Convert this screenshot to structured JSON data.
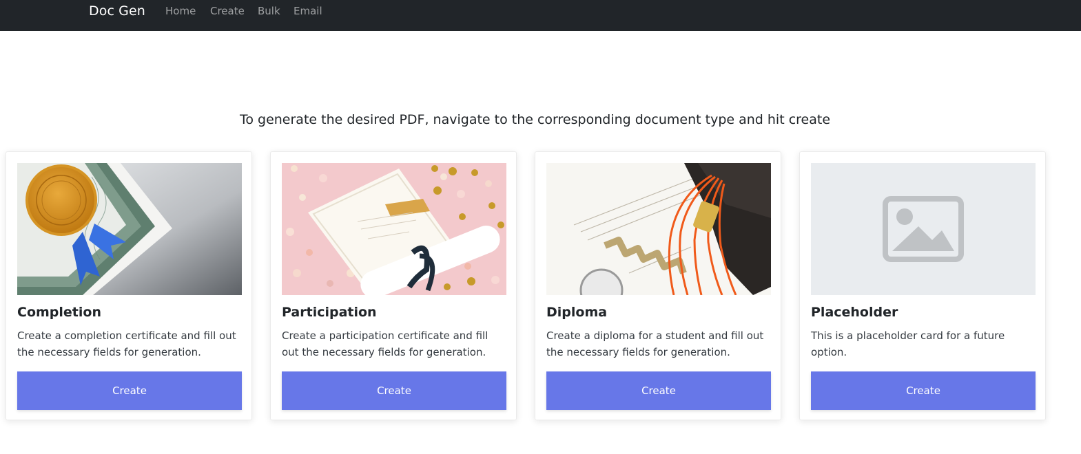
{
  "navbar": {
    "brand": "Doc Gen",
    "links": [
      {
        "label": "Home"
      },
      {
        "label": "Create"
      },
      {
        "label": "Bulk"
      },
      {
        "label": "Email"
      }
    ],
    "background": "#212529"
  },
  "main": {
    "headline": "To generate the desired PDF, navigate to the corresponding document type and hit create"
  },
  "cards": [
    {
      "title": "Completion",
      "text": "Create a completion certificate and fill out the necessary fields for generation.",
      "button": "Create",
      "image_icon": "certificate-seal-image"
    },
    {
      "title": "Participation",
      "text": "Create a participation certificate and fill out the necessary fields for generation.",
      "button": "Create",
      "image_icon": "certificate-confetti-image"
    },
    {
      "title": "Diploma",
      "text": "Create a diploma for a student and fill out the necessary fields for generation.",
      "button": "Create",
      "image_icon": "diploma-tassel-image"
    },
    {
      "title": "Placeholder",
      "text": "This is a placeholder card for a future option.",
      "button": "Create",
      "image_icon": "placeholder-image-icon"
    }
  ],
  "colors": {
    "accent": "#6777e8",
    "placeholder_bg": "#e9ecef",
    "placeholder_icon": "#bfc2c5"
  }
}
